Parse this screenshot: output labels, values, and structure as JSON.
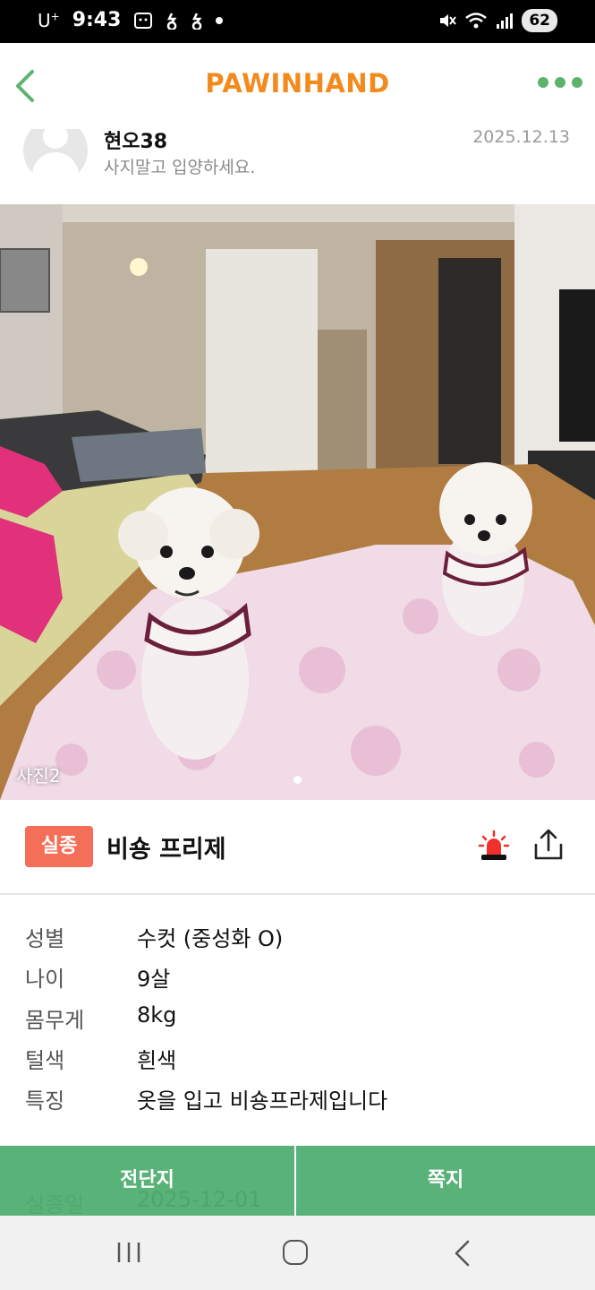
{
  "status_bar": {
    "carrier": "U",
    "carrier_sup": "+",
    "time": "9:43",
    "battery": "62",
    "icons": [
      "screenshot-icon",
      "notification-icon",
      "notification-icon",
      "dot-icon",
      "mute-icon",
      "wifi-icon",
      "signal-icon"
    ]
  },
  "header": {
    "brand": "PAWINHAND",
    "brand_color": "#f28a1d",
    "accent_color": "#5db36e"
  },
  "author": {
    "name": "현오38",
    "message": "사지말고 입양하세요.",
    "date": "2025.12.13"
  },
  "photo": {
    "label": "사진2"
  },
  "post": {
    "status_badge": "실종",
    "badge_color": "#f46f58",
    "breed": "비숑 프리제"
  },
  "details": [
    {
      "key": "성별",
      "value": "수컷 (중성화 O)"
    },
    {
      "key": "나이",
      "value": "9살"
    },
    {
      "key": "몸무게",
      "value": "8kg"
    },
    {
      "key": "털색",
      "value": "흰색"
    },
    {
      "key": "특징",
      "value": "옷을 입고 비숑프라제입니다"
    },
    {
      "key": "실종일",
      "value": "2025-12-01"
    }
  ],
  "actions": {
    "flyer": "전단지",
    "message": "쪽지"
  }
}
